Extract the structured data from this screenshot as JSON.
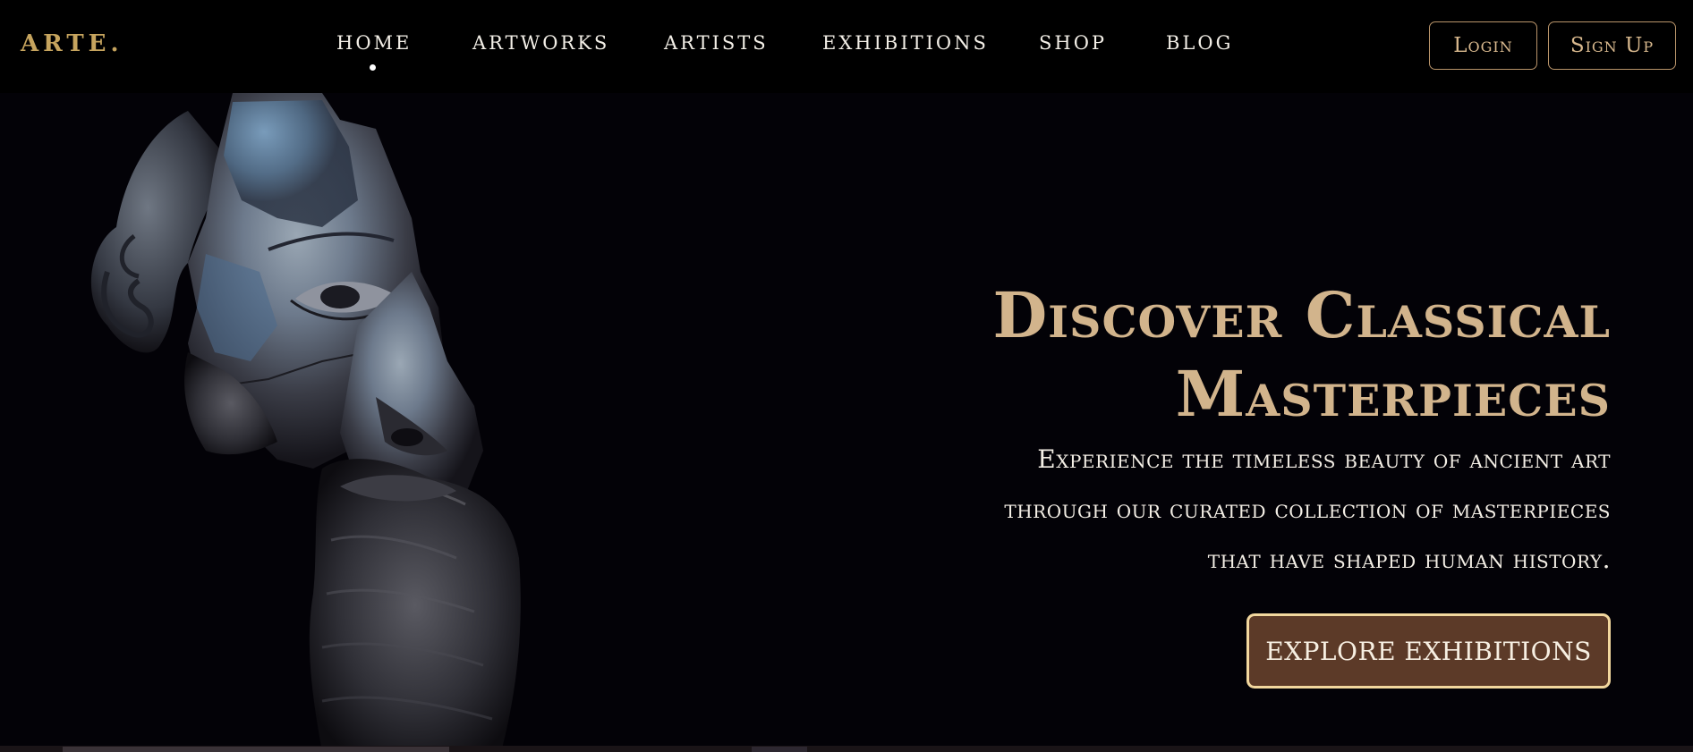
{
  "brand": {
    "logo": "ARTE."
  },
  "nav": {
    "items": [
      {
        "label": "HOME",
        "active": true
      },
      {
        "label": "ARTWORKS",
        "active": false
      },
      {
        "label": "ARTISTS",
        "active": false
      },
      {
        "label": "EXHIBITIONS",
        "active": false
      },
      {
        "label": "SHOP",
        "active": false
      },
      {
        "label": "BLOG",
        "active": false
      }
    ],
    "login_label": "Login",
    "signup_label": "Sign Up"
  },
  "hero": {
    "title_line1": "Discover Classical",
    "title_line2": "Masterpieces",
    "subtitle_line1": "Experience the timeless beauty of ancient art",
    "subtitle_line2": "through our curated collection of masterpieces",
    "subtitle_line3": "that have shaped human history.",
    "cta_label": "EXPLORE EXHIBITIONS",
    "image_subject": "bronze-head-sculpture"
  },
  "colors": {
    "background": "#030207",
    "navbar": "#000000",
    "logo_gold": "#c6a45e",
    "title_tan": "#d2b48c",
    "button_brown": "#5c3a28",
    "button_border": "#f2d79e",
    "auth_border": "#b9946a"
  }
}
